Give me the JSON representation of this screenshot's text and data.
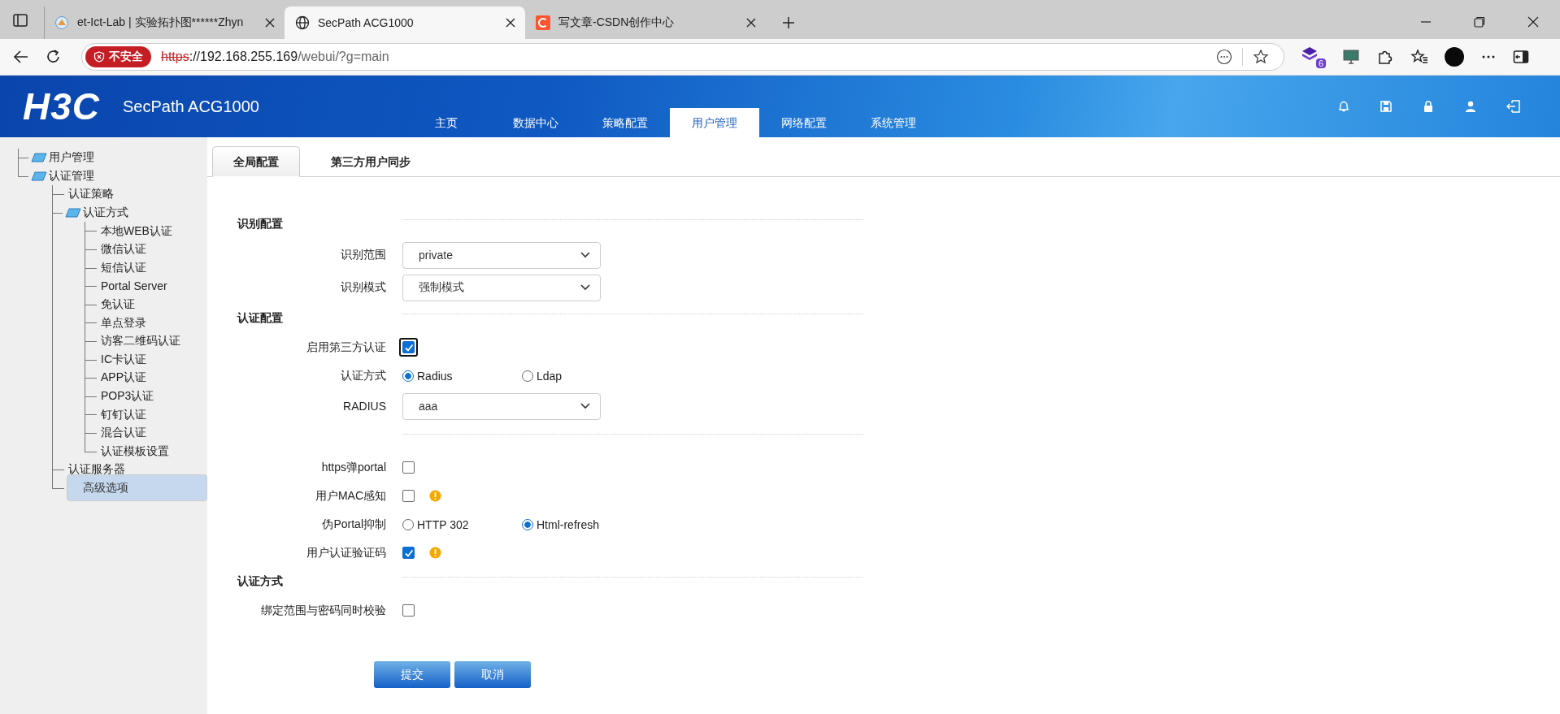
{
  "browser": {
    "tabs": [
      {
        "title": "et-Ict-Lab | 实验拓扑图******Zhyn",
        "selected": false
      },
      {
        "title": "SecPath ACG1000",
        "selected": true
      },
      {
        "title": "写文章-CSDN创作中心",
        "selected": false
      }
    ],
    "security_badge": "不安全",
    "url": {
      "scheme": "https",
      "host": "://192.168.255.169",
      "path": "/webui/?g=main"
    },
    "extension_badge": "6"
  },
  "header": {
    "logo": "H3C",
    "product": "SecPath ACG1000",
    "nav": [
      {
        "label": "主页",
        "selected": false
      },
      {
        "label": "数据中心",
        "selected": false
      },
      {
        "label": "策略配置",
        "selected": false
      },
      {
        "label": "用户管理",
        "selected": true
      },
      {
        "label": "网络配置",
        "selected": false
      },
      {
        "label": "系统管理",
        "selected": false
      }
    ]
  },
  "sidebar": {
    "tree": [
      {
        "label": "用户管理",
        "kind": "folder",
        "selected": false
      },
      {
        "label": "认证管理",
        "kind": "folder",
        "selected": false,
        "children": [
          {
            "label": "认证策略",
            "kind": "leaf",
            "selected": false
          },
          {
            "label": "认证方式",
            "kind": "folder",
            "selected": false,
            "children": [
              {
                "label": "本地WEB认证",
                "kind": "leaf",
                "selected": false
              },
              {
                "label": "微信认证",
                "kind": "leaf",
                "selected": false
              },
              {
                "label": "短信认证",
                "kind": "leaf",
                "selected": false
              },
              {
                "label": "Portal Server",
                "kind": "leaf",
                "selected": false
              },
              {
                "label": "免认证",
                "kind": "leaf",
                "selected": false
              },
              {
                "label": "单点登录",
                "kind": "leaf",
                "selected": false
              },
              {
                "label": "访客二维码认证",
                "kind": "leaf",
                "selected": false
              },
              {
                "label": "IC卡认证",
                "kind": "leaf",
                "selected": false
              },
              {
                "label": "APP认证",
                "kind": "leaf",
                "selected": false
              },
              {
                "label": "POP3认证",
                "kind": "leaf",
                "selected": false
              },
              {
                "label": "钉钉认证",
                "kind": "leaf",
                "selected": false
              },
              {
                "label": "混合认证",
                "kind": "leaf",
                "selected": false
              },
              {
                "label": "认证模板设置",
                "kind": "leaf",
                "selected": false
              }
            ]
          },
          {
            "label": "认证服务器",
            "kind": "leaf",
            "selected": false
          },
          {
            "label": "高级选项",
            "kind": "leaf",
            "selected": true
          }
        ]
      }
    ]
  },
  "tabs": [
    {
      "label": "全局配置",
      "selected": true
    },
    {
      "label": "第三方用户同步",
      "selected": false
    }
  ],
  "form": {
    "rows": [
      {
        "kind": "section",
        "label": "识别配置"
      },
      {
        "kind": "select",
        "label": "识别范围",
        "value": "private"
      },
      {
        "kind": "select",
        "label": "识别模式",
        "value": "强制模式"
      },
      {
        "kind": "section",
        "label": "认证配置"
      },
      {
        "kind": "checkbox",
        "label": "启用第三方认证",
        "checked": true,
        "focused": true,
        "hint": false
      },
      {
        "kind": "radio",
        "label": "认证方式",
        "options": [
          {
            "label": "Radius",
            "selected": true
          },
          {
            "label": "Ldap",
            "selected": false
          }
        ]
      },
      {
        "kind": "select",
        "label": "RADIUS",
        "value": "aaa"
      },
      {
        "kind": "divider"
      },
      {
        "kind": "checkbox",
        "label": "https弹portal",
        "checked": false,
        "focused": false,
        "hint": false
      },
      {
        "kind": "checkbox",
        "label": "用户MAC感知",
        "checked": false,
        "focused": false,
        "hint": true
      },
      {
        "kind": "radio",
        "label": "伪Portal抑制",
        "options": [
          {
            "label": "HTTP 302",
            "selected": false
          },
          {
            "label": "Html-refresh",
            "selected": true
          }
        ]
      },
      {
        "kind": "checkbox",
        "label": "用户认证验证码",
        "checked": true,
        "focused": false,
        "hint": true
      },
      {
        "kind": "section",
        "label": "认证方式"
      },
      {
        "kind": "checkbox",
        "label": "绑定范围与密码同时校验",
        "checked": false,
        "focused": false,
        "hint": false
      }
    ]
  },
  "buttons": [
    {
      "label": "提交"
    },
    {
      "label": "取消"
    }
  ]
}
